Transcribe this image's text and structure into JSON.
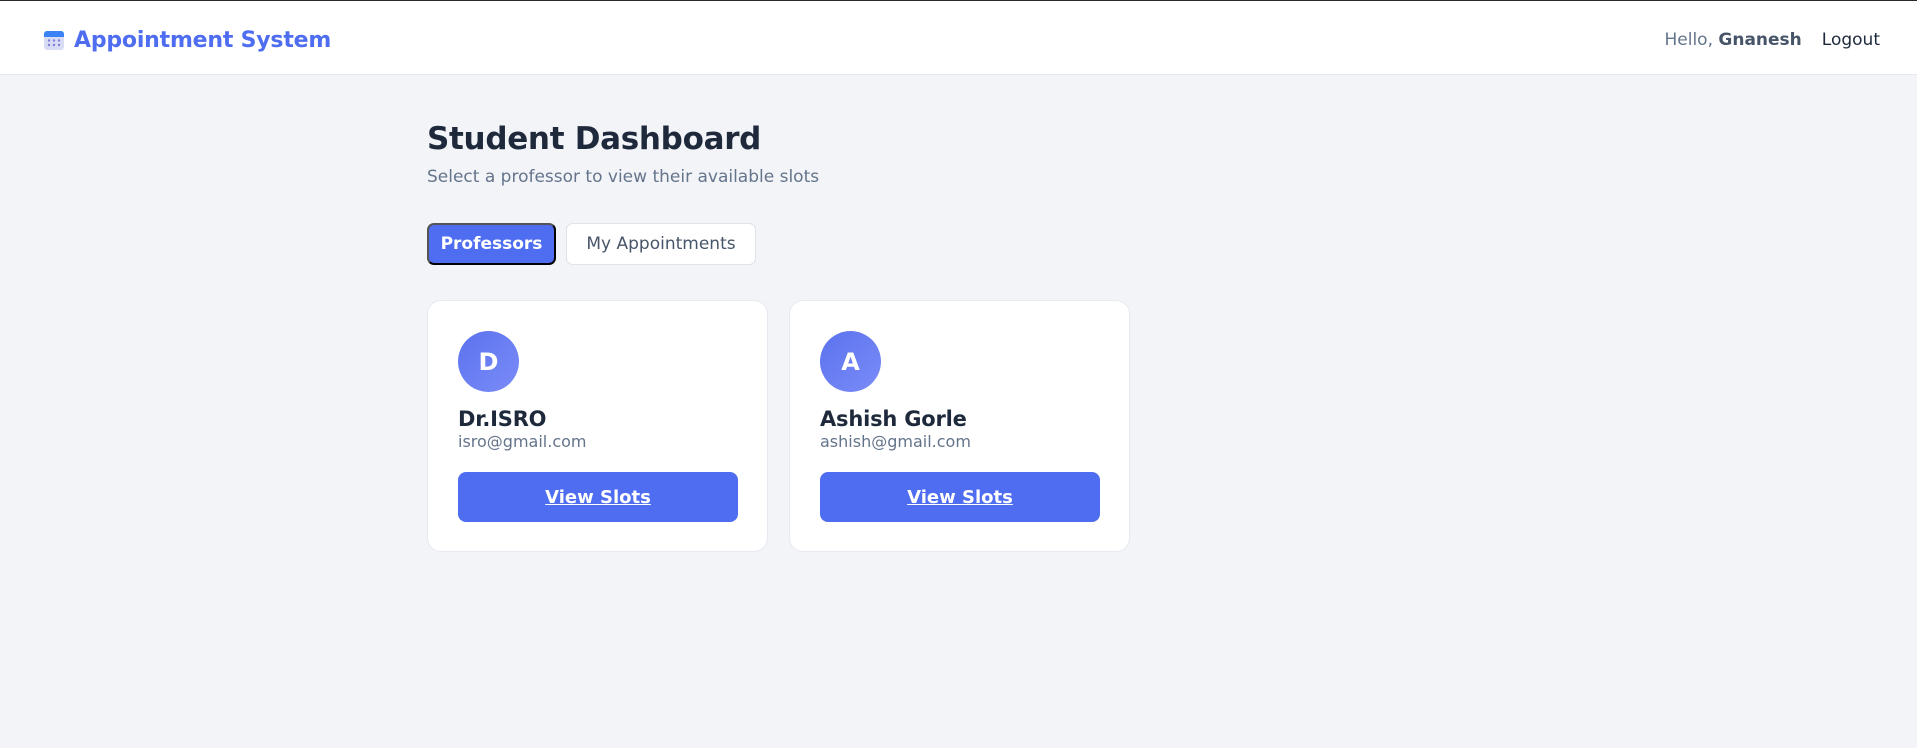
{
  "colors": {
    "accent": "#4f6df0",
    "background": "#f3f4f8",
    "text": "#1e293b",
    "muted": "#64748b"
  },
  "navbar": {
    "brand_icon": "calendar-icon",
    "brand_title": "Appointment System",
    "greeting": "Hello,",
    "user_name": "Gnanesh",
    "logout_label": "Logout"
  },
  "page": {
    "title": "Student Dashboard",
    "subtitle": "Select a professor to view their available slots"
  },
  "tabs": [
    {
      "label": "Professors",
      "active": true
    },
    {
      "label": "My Appointments",
      "active": false
    }
  ],
  "professors": [
    {
      "initial": "D",
      "name": "Dr.ISRO",
      "email": "isro@gmail.com",
      "button_label": "View Slots"
    },
    {
      "initial": "A",
      "name": "Ashish Gorle",
      "email": "ashish@gmail.com",
      "button_label": "View Slots"
    }
  ]
}
